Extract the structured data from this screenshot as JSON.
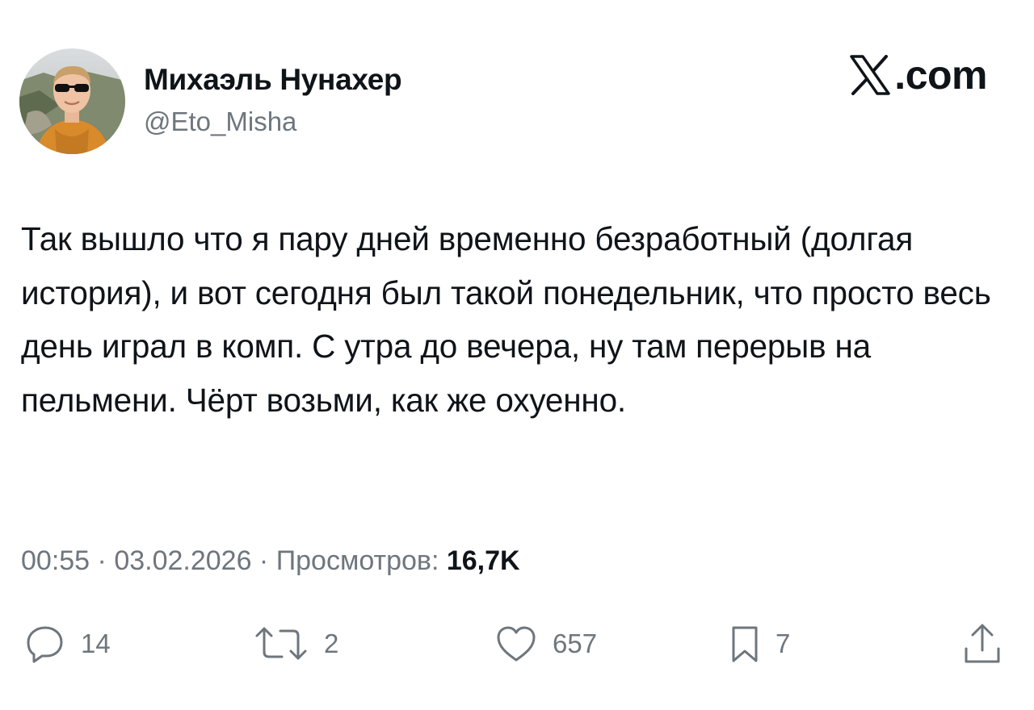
{
  "author": {
    "display_name": "Михаэль Нунахер",
    "handle": "@Eto_Misha"
  },
  "brand": {
    "text": ".com",
    "icon": "x-logo-icon"
  },
  "tweet": {
    "text": "Так вышло что я пару дней временно безработный (долгая история), и вот сегодня был такой понедельник, что просто весь день играл в комп. С утра до вечера, ну там перерыв на пельмени. Чёрт возьми, как же охуенно.",
    "time": "00:55",
    "separator": " · ",
    "date": "03.02.2026",
    "views_label": "Просмотров: ",
    "views_count": "16,7K"
  },
  "actions": {
    "replies": {
      "icon": "reply-icon",
      "count": "14"
    },
    "retweets": {
      "icon": "retweet-icon",
      "count": "2"
    },
    "likes": {
      "icon": "heart-icon",
      "count": "657"
    },
    "bookmarks": {
      "icon": "bookmark-icon",
      "count": "7"
    },
    "share": {
      "icon": "share-icon"
    }
  },
  "colors": {
    "text": "#0f1419",
    "secondary": "#6e767d",
    "background": "#ffffff"
  }
}
